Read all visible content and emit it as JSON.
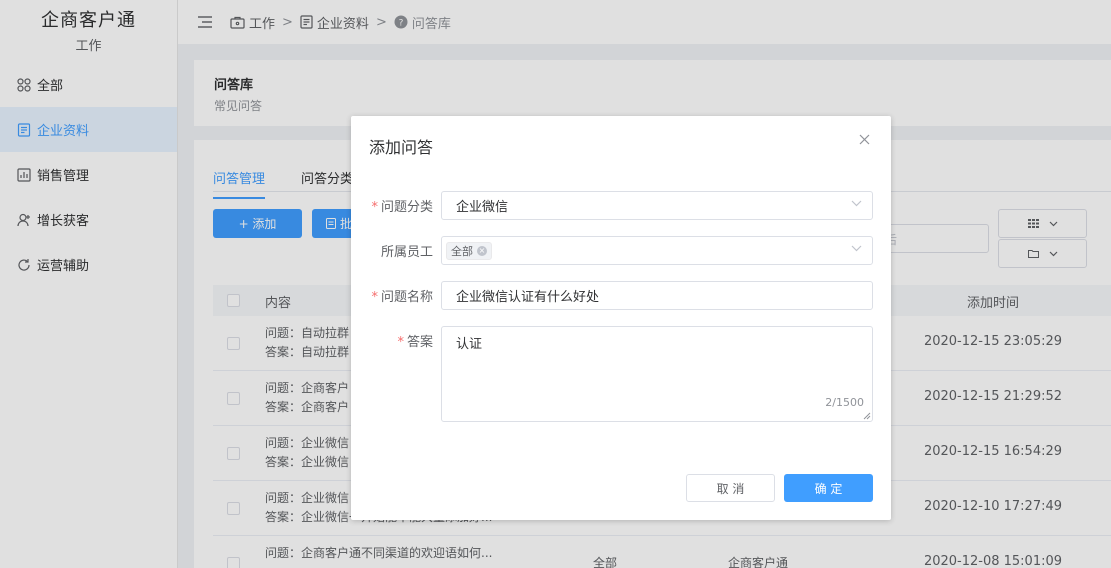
{
  "app": {
    "name": "企商客户通",
    "section": "工作"
  },
  "sidebar": {
    "items": [
      {
        "label": "全部",
        "icon": "grid-icon"
      },
      {
        "label": "企业资料",
        "icon": "document-icon",
        "active": true
      },
      {
        "label": "销售管理",
        "icon": "chart-icon"
      },
      {
        "label": "增长获客",
        "icon": "user-add-icon"
      },
      {
        "label": "运营辅助",
        "icon": "refresh-icon"
      }
    ]
  },
  "breadcrumb": {
    "items": [
      "工作",
      "企业资料",
      "问答库"
    ],
    "separator": ">"
  },
  "page": {
    "title": "问答库",
    "subtitle": "常见问答"
  },
  "tabs": [
    {
      "label": "问答管理",
      "active": true
    },
    {
      "label": "问答分类"
    }
  ],
  "toolbar": {
    "add_label": "+ 添加",
    "batch_label": "批",
    "search_placeholder": "后"
  },
  "table": {
    "headers": {
      "content": "内容",
      "time": "添加时间"
    },
    "rows": [
      {
        "question": "问题：自动拉群",
        "answer": "答案：自动拉群",
        "range": "",
        "employee": "",
        "time": "2020-12-15 23:05:29"
      },
      {
        "question": "问题：企商客户",
        "answer": "答案：企商客户",
        "range": "",
        "employee": "",
        "time": "2020-12-15 21:29:52"
      },
      {
        "question": "问题：企业微信",
        "answer": "答案：企业微信",
        "range": "",
        "employee": "",
        "time": "2020-12-15 16:54:29"
      },
      {
        "question": "问题：企业微信",
        "answer": "答案：企业微信一开始能不能大量添加好...",
        "range": "",
        "employee": "",
        "time": "2020-12-10 17:27:49"
      },
      {
        "question": "问题：企商客户通不同渠道的欢迎语如何...",
        "answer": "",
        "range": "全部",
        "employee": "企商客户通",
        "time": "2020-12-08 15:01:09"
      }
    ]
  },
  "dialog": {
    "title": "添加问答",
    "fields": {
      "category_label": "问题分类",
      "category_value": "企业微信",
      "employee_label": "所属员工",
      "employee_tag": "全部",
      "question_label": "问题名称",
      "question_value": "企业微信认证有什么好处",
      "answer_label": "答案",
      "answer_value": "认证",
      "answer_counter": "2/1500"
    },
    "cancel_label": "取 消",
    "ok_label": "确 定"
  },
  "colors": {
    "primary": "#409eff",
    "required": "#f56c6c",
    "sidebar_active_bg": "#e8f3ff"
  }
}
